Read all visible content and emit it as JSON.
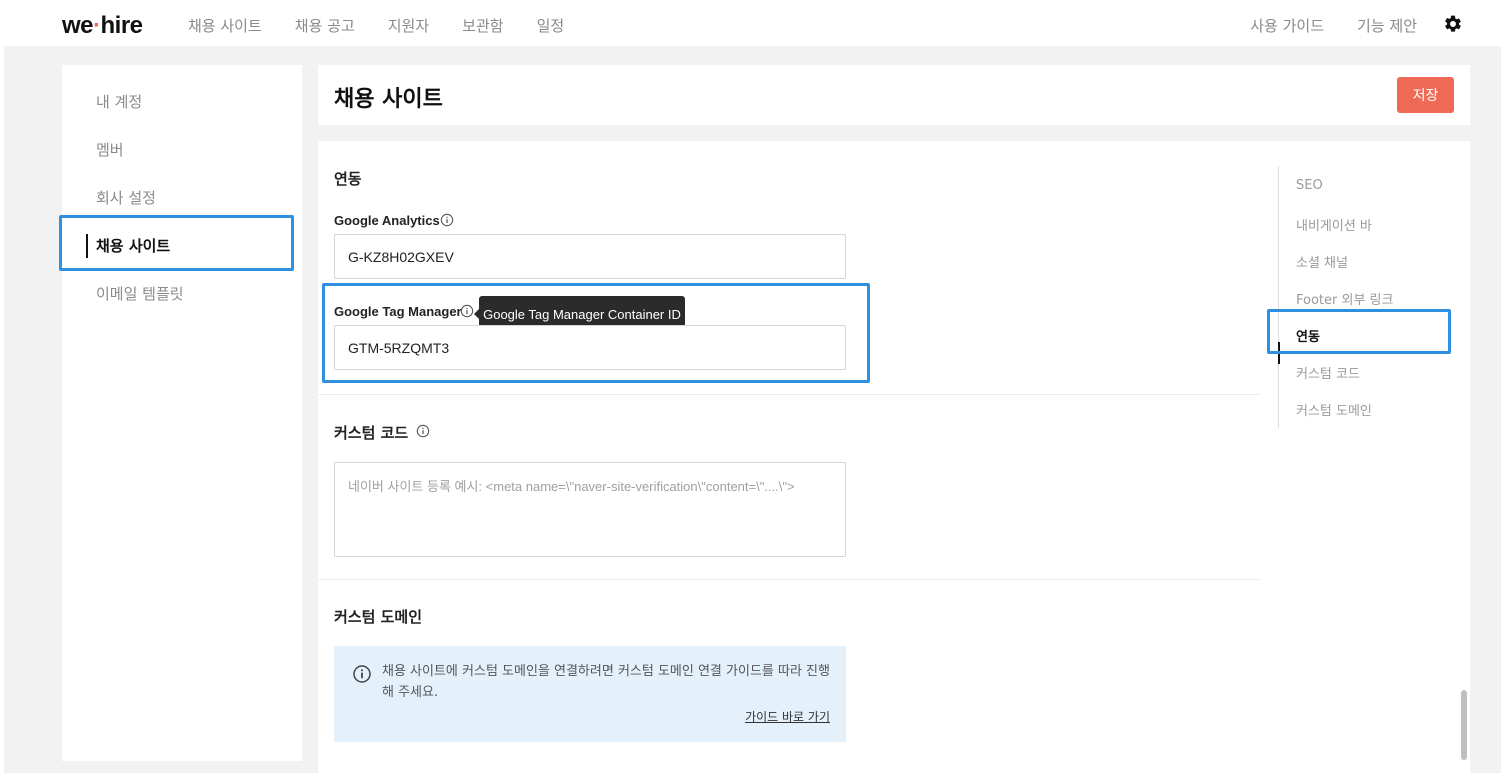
{
  "app": {
    "logo_left": "we",
    "logo_dot": "·",
    "logo_right": "hire"
  },
  "nav": {
    "links": [
      "채용 사이트",
      "채용 공고",
      "지원자",
      "보관함",
      "일정"
    ],
    "right_links": [
      "사용 가이드",
      "기능 제안"
    ]
  },
  "sidebar": {
    "items": [
      {
        "label": "내 계정"
      },
      {
        "label": "멤버"
      },
      {
        "label": "회사 설정"
      },
      {
        "label": "채용 사이트"
      },
      {
        "label": "이메일 템플릿"
      }
    ],
    "active_index": 3
  },
  "header": {
    "title": "채용 사이트",
    "save_label": "저장"
  },
  "integration": {
    "title": "연동",
    "ga_label": "Google Analytics",
    "ga_value": "G-KZ8H02GXEV",
    "gtm_label": "Google Tag Manager",
    "gtm_value": "GTM-5RZQMT3",
    "gtm_tooltip": "Google Tag Manager Container ID"
  },
  "custom_code": {
    "title": "커스텀 코드",
    "placeholder": "네이버 사이트 등록 예시: <meta name=\\\"naver-site-verification\\\"content=\\\"....\\\">"
  },
  "custom_domain": {
    "title": "커스텀 도메인",
    "notice_text": "채용 사이트에 커스텀 도메인을 연결하려면 커스텀 도메인 연결 가이드를 따라 진행해 주세요.",
    "guide_link": "가이드 바로 가기"
  },
  "toc": {
    "items": [
      "SEO",
      "내비게이션 바",
      "소셜 채널",
      "Footer 외부 링크",
      "연동",
      "커스텀 코드",
      "커스텀 도메인"
    ],
    "active_index": 4
  },
  "colors": {
    "accent": "#ef6a56",
    "highlight": "#2f8fe0",
    "notice_bg": "#e4f1fb"
  },
  "icons": {
    "settings": "gear-icon",
    "info": "info-icon"
  }
}
